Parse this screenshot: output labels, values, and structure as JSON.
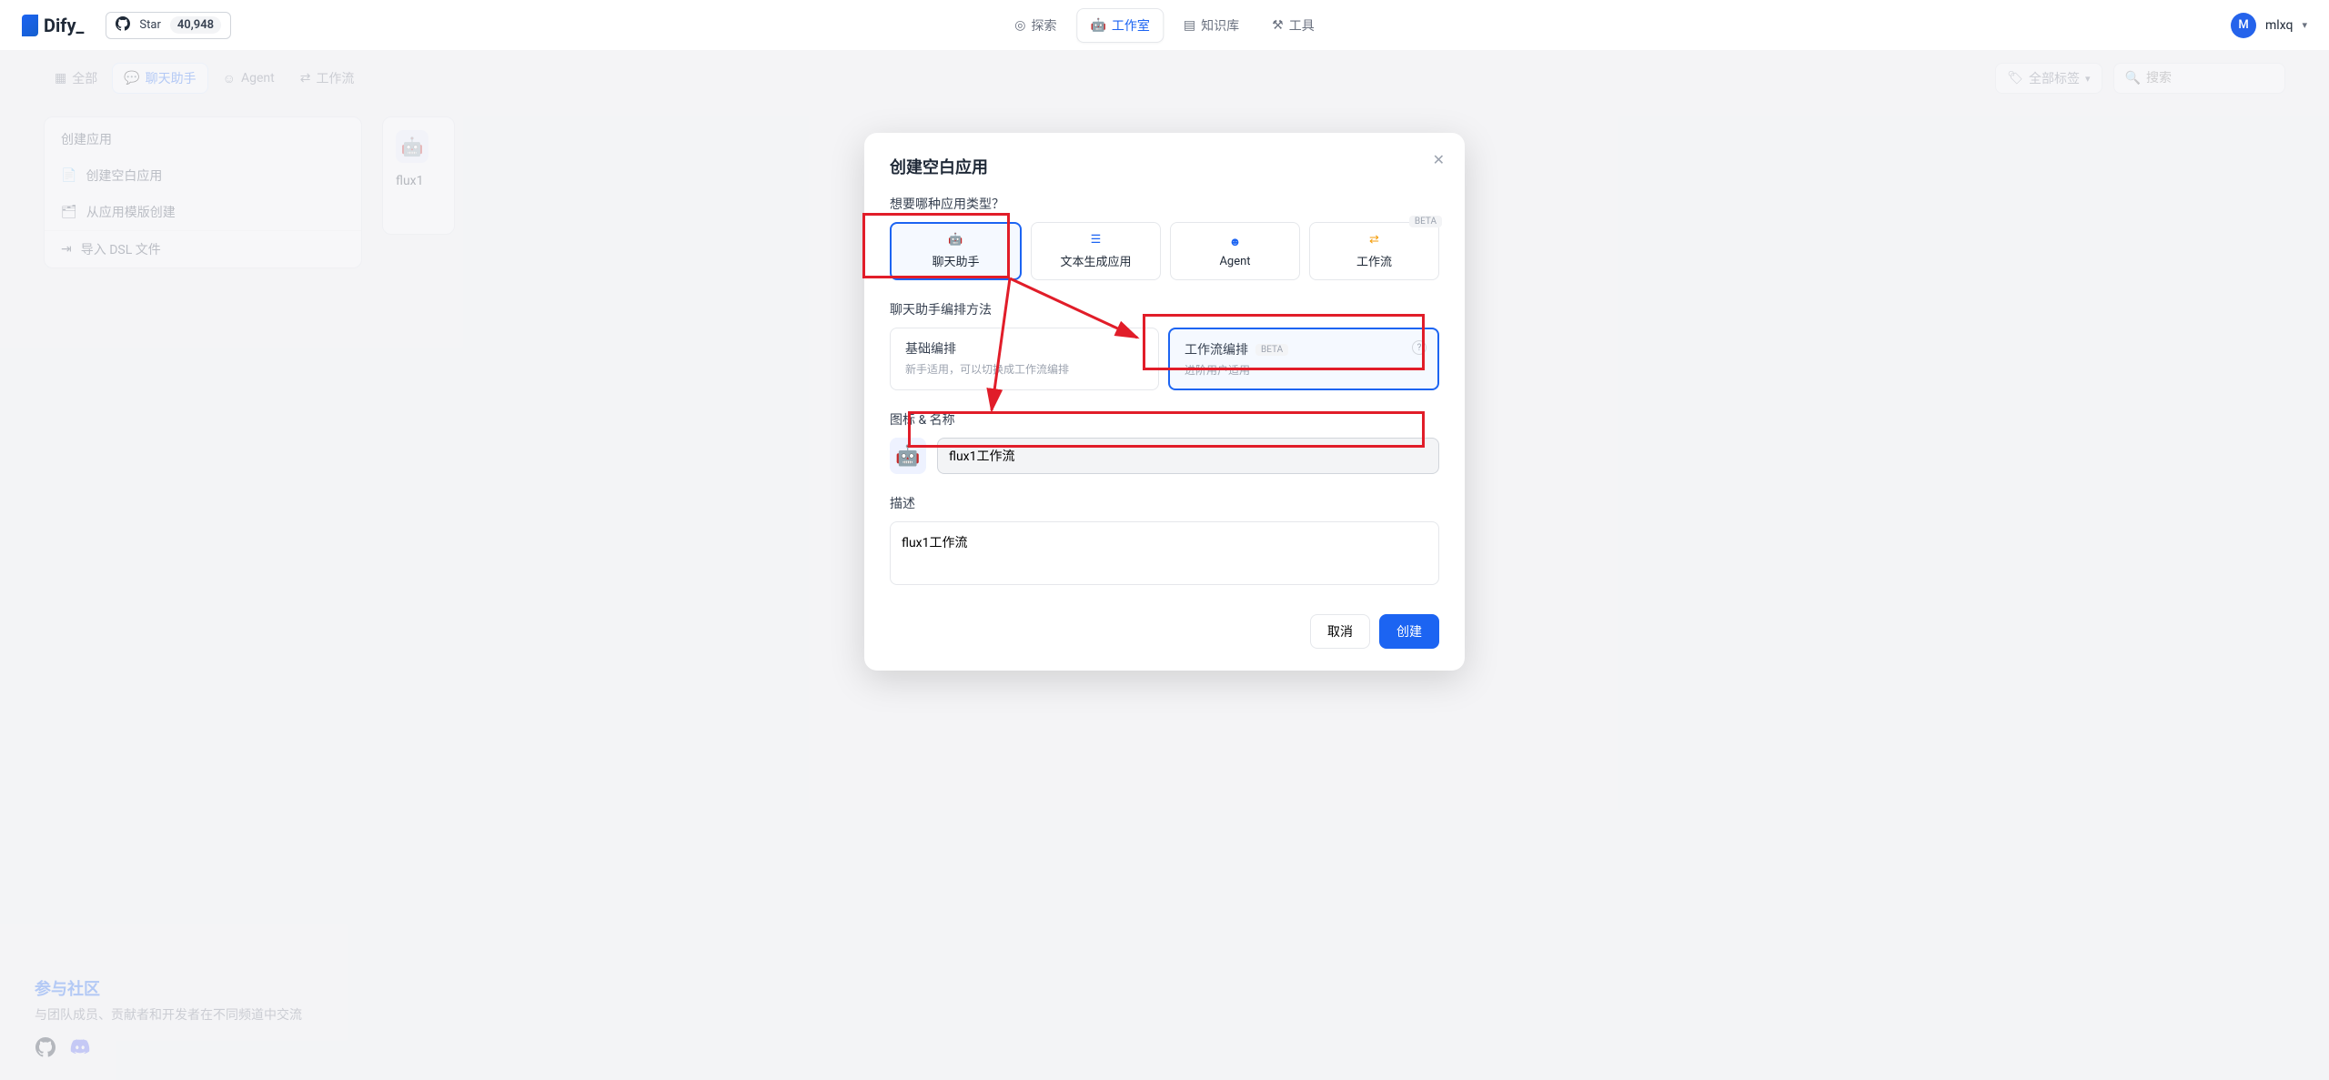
{
  "header": {
    "logo_text": "Dify_",
    "github_star_label": "Star",
    "github_star_count": "40,948",
    "nav": {
      "explore": "探索",
      "workspace": "工作室",
      "knowledge": "知识库",
      "tools": "工具"
    },
    "user_initial": "M",
    "user_name": "mlxq"
  },
  "filters": {
    "all": "全部",
    "chat": "聊天助手",
    "agent": "Agent",
    "workflow": "工作流",
    "all_tags": "全部标签",
    "search_placeholder": "搜索"
  },
  "create_card": {
    "title": "创建应用",
    "blank": "创建空白应用",
    "template": "从应用模版创建",
    "import_dsl": "导入 DSL 文件"
  },
  "app_preview": {
    "title": "flux1"
  },
  "community": {
    "title": "参与社区",
    "subtitle": "与团队成员、贡献者和开发者在不同频道中交流"
  },
  "modal": {
    "title": "创建空白应用",
    "q_type": "想要哪种应用类型？",
    "types": {
      "chat": "聊天助手",
      "textgen": "文本生成应用",
      "agent": "Agent",
      "workflow": "工作流"
    },
    "beta_label": "BETA",
    "q_arrange": "聊天助手编排方法",
    "arrange": {
      "basic_title": "基础编排",
      "basic_sub": "新手适用，可以切换成工作流编排",
      "workflow_title": "工作流编排",
      "workflow_sub": "进阶用户适用"
    },
    "icon_name_label": "图标 & 名称",
    "name_value": "flux1工作流",
    "desc_label": "描述",
    "desc_value": "flux1工作流",
    "cancel": "取消",
    "create": "创建"
  }
}
